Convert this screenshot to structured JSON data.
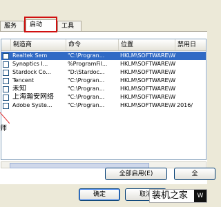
{
  "tabs": [
    {
      "label": "服务"
    },
    {
      "label": "启动"
    },
    {
      "label": "工具"
    }
  ],
  "list": {
    "columns": [
      "制造商",
      "命令",
      "位置",
      "禁用日"
    ],
    "rows": [
      {
        "name": "Realtek Sem",
        "cmd": "\"C:\\Progran...",
        "loc": "HKLM\\SOFTWARE\\W...",
        "date": "",
        "selected": true
      },
      {
        "name": "Synaptics I...",
        "cmd": "%ProgramFil...",
        "loc": "HKLM\\SOFTWARE\\W...",
        "date": "",
        "selected": false
      },
      {
        "name": "Stardock Co...",
        "cmd": "\"D:\\Stardoc...",
        "loc": "HKLM\\SOFTWARE\\W...",
        "date": "",
        "selected": false
      },
      {
        "name": "Tencent",
        "cmd": "\"C:\\Progran...",
        "loc": "HKLM\\SOFTWARE\\W...",
        "date": "",
        "selected": false
      },
      {
        "name": "未知",
        "cmd": "\"C:\\Progran...",
        "loc": "HKLM\\SOFTWARE\\W...",
        "date": "",
        "selected": false
      },
      {
        "name": "上海瀚安网络",
        "cmd": "\"C:\\Progran...",
        "loc": "HKLM\\SOFTWARE\\W...",
        "date": "",
        "selected": false
      },
      {
        "name": "Adobe Syste...",
        "cmd": "\"C:\\Progran...",
        "loc": "HKLM\\SOFTWARE\\W...",
        "date": "2016/",
        "selected": false
      }
    ],
    "side_text": "师"
  },
  "buttons": {
    "enable_all": "全部启用(E)",
    "disable_all": "全",
    "ok": "确定",
    "cancel": "取消"
  },
  "watermark": {
    "text": "装机之家",
    "badge": "W"
  },
  "colors": {
    "selection": "#316ac5",
    "highlight_box": "#d01010"
  }
}
